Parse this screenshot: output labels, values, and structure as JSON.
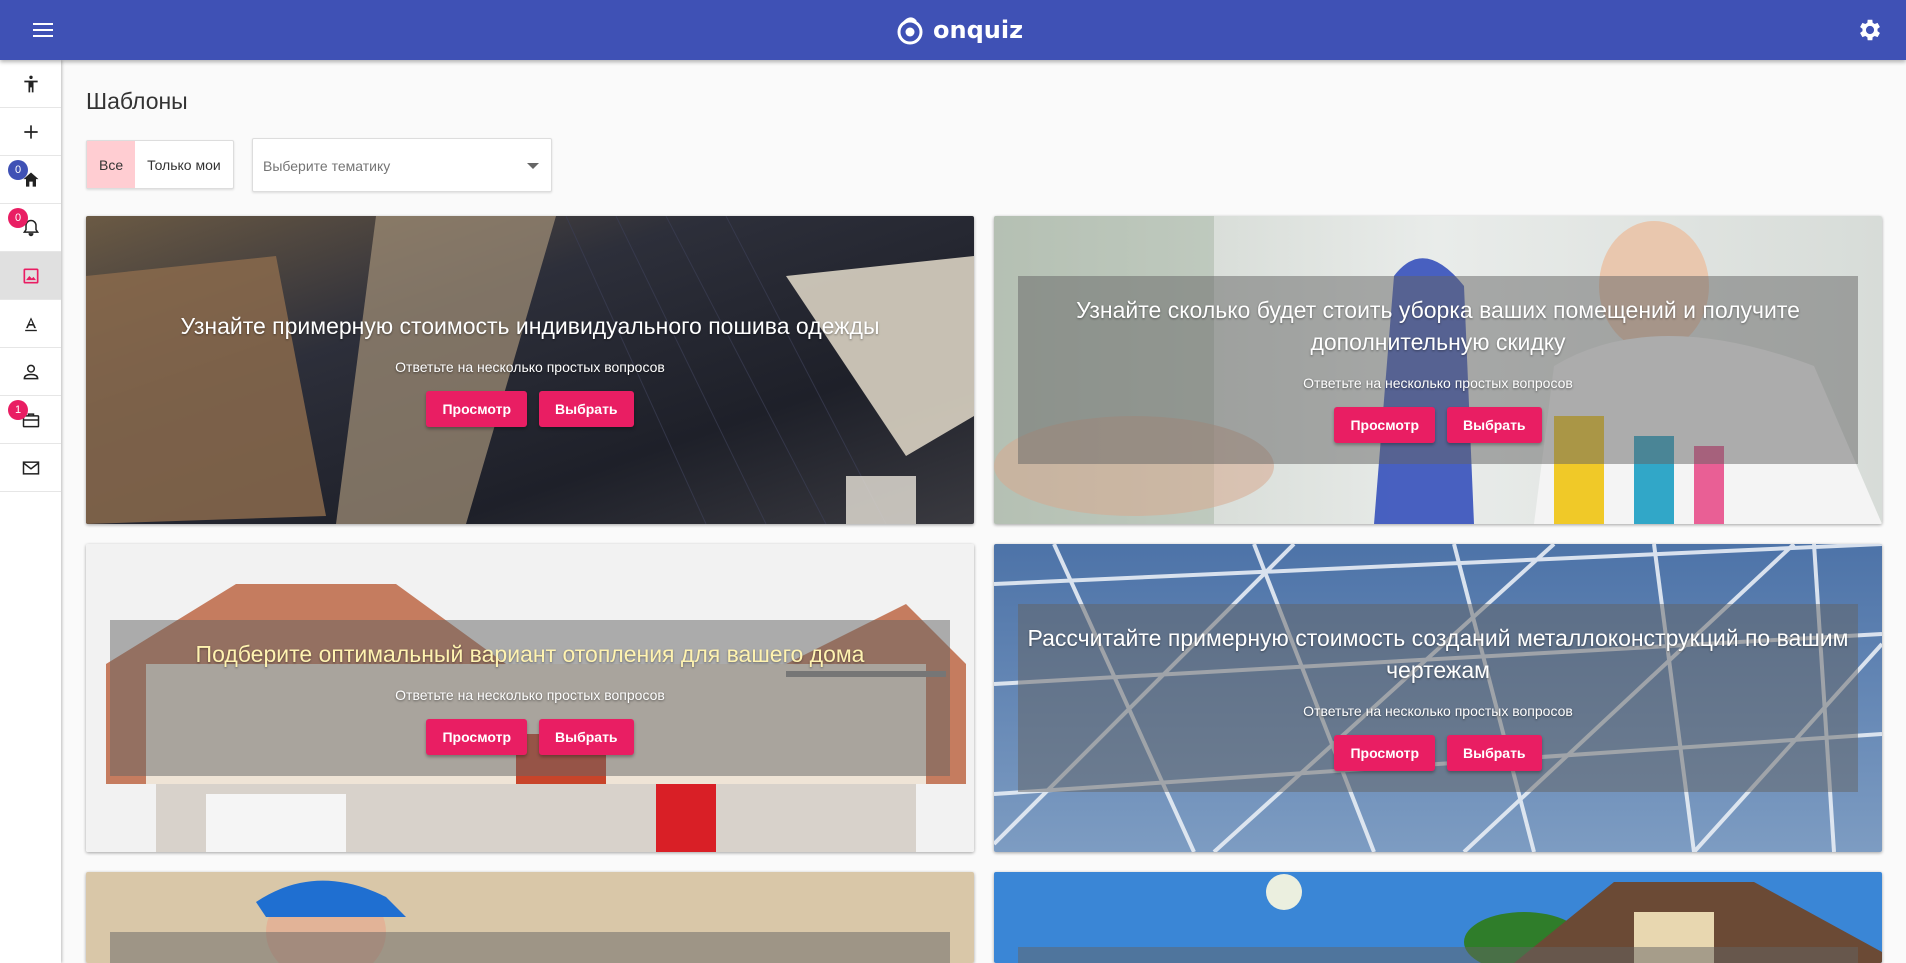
{
  "app": {
    "brand": "onquiz"
  },
  "sidebar": {
    "badges": {
      "home": "0",
      "notifications": "0",
      "briefcase": "1"
    }
  },
  "page": {
    "title": "Шаблоны"
  },
  "filters": {
    "toggle_all": "Все",
    "toggle_mine": "Только мои",
    "topic_placeholder": "Выберите тематику"
  },
  "cards": [
    {
      "title": "Узнайте примерную стоимость индивидуального пошива одежды",
      "subtitle": "Ответьте на несколько простых вопросов",
      "preview_label": "Просмотр",
      "select_label": "Выбрать"
    },
    {
      "title": "Узнайте сколько будет стоить уборка ваших помещений и получите дополнительную скидку",
      "subtitle": "Ответьте на несколько простых вопросов",
      "preview_label": "Просмотр",
      "select_label": "Выбрать"
    },
    {
      "title": "Подберите оптимальный вариант отопления для вашего дома",
      "subtitle": "Ответьте на несколько простых вопросов",
      "preview_label": "Просмотр",
      "select_label": "Выбрать"
    },
    {
      "title": "Рассчитайте примерную стоимость созданий металлоконструкций по вашим чертежам",
      "subtitle": "Ответьте на несколько простых вопросов",
      "preview_label": "Просмотр",
      "select_label": "Выбрать"
    }
  ],
  "colors": {
    "primary": "#3f51b5",
    "accent": "#e91e63",
    "toggle_active": "#ffcdd2"
  }
}
